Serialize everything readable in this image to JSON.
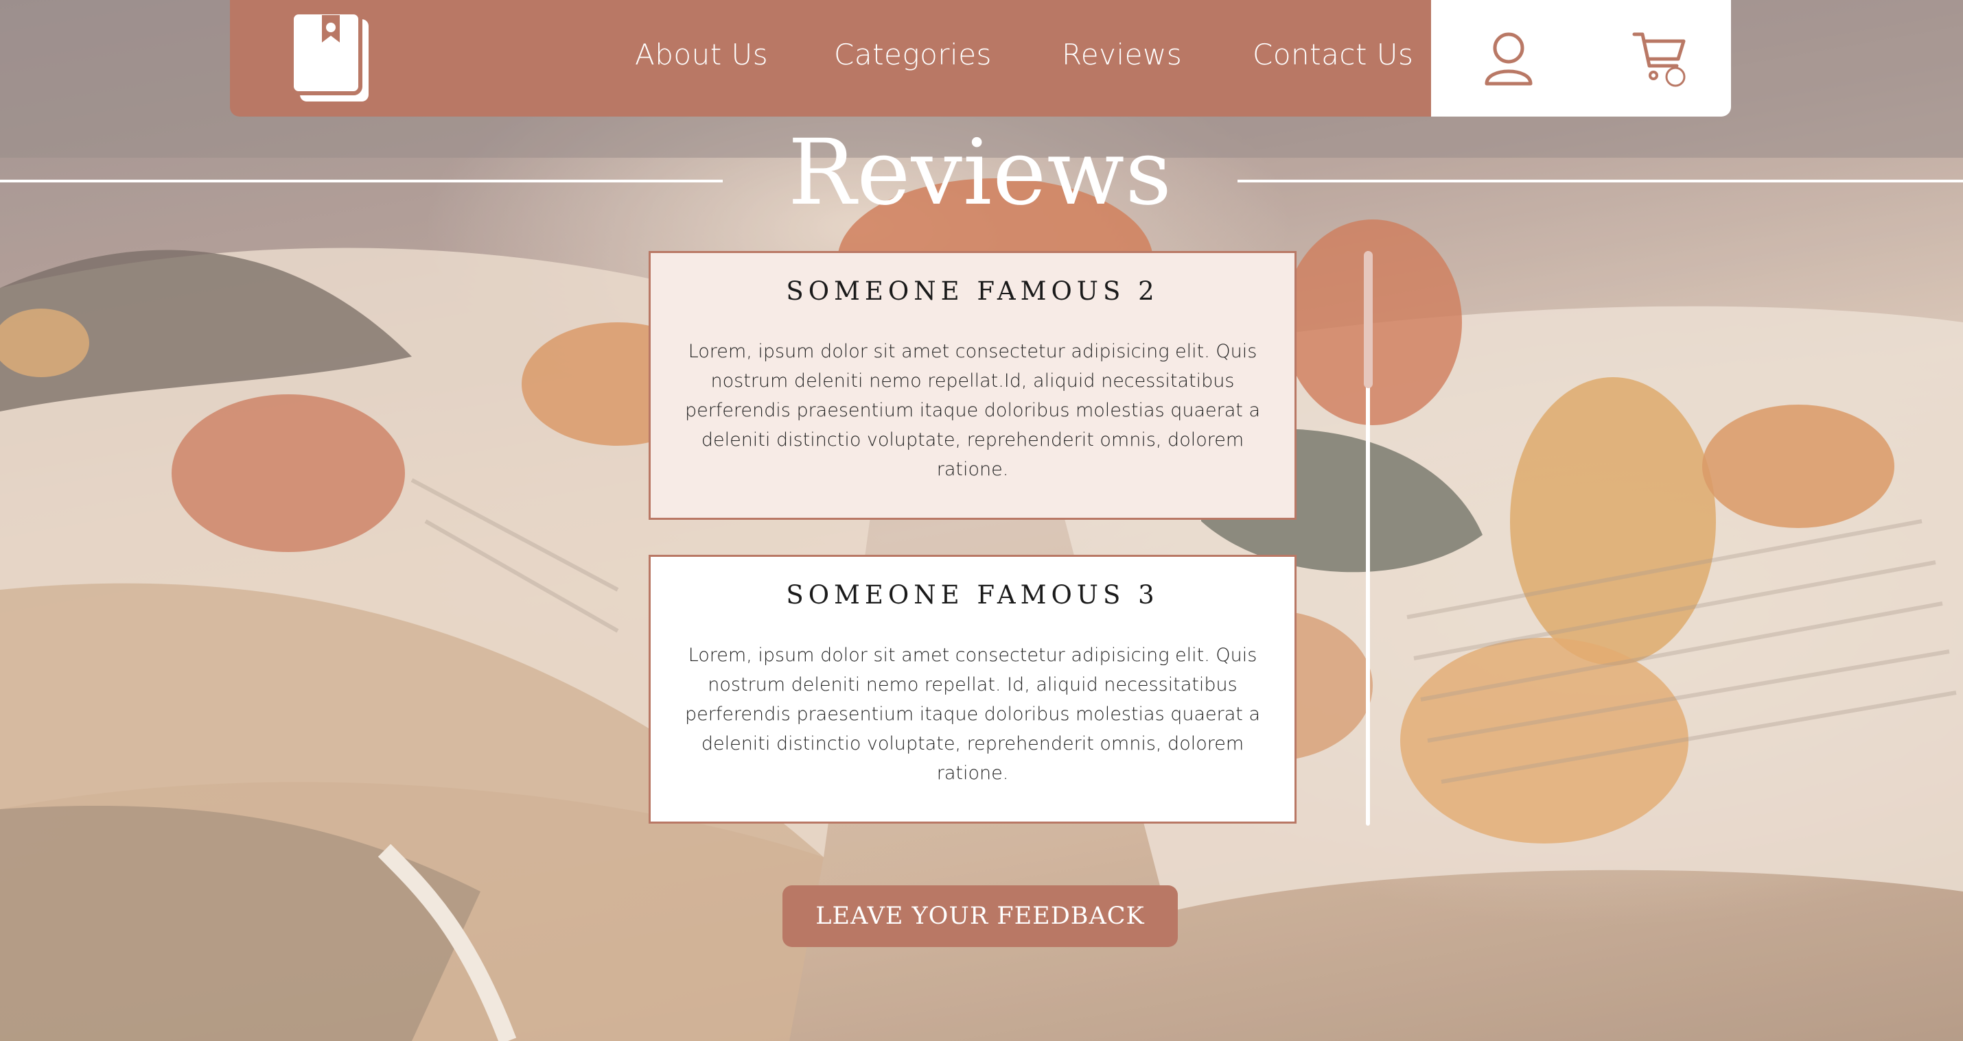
{
  "colors": {
    "brand": "#b97865",
    "card_highlight": "#f7ebe6",
    "white": "#ffffff",
    "scroll_thumb": "#e6c7bd"
  },
  "header": {
    "logo_icon": "book-bookmark-icon",
    "nav": [
      {
        "label": "About Us"
      },
      {
        "label": "Categories"
      },
      {
        "label": "Reviews"
      },
      {
        "label": "Contact Us"
      }
    ],
    "actions": {
      "user_icon": "user-icon",
      "cart_icon": "cart-icon"
    }
  },
  "section": {
    "title": "Reviews"
  },
  "reviews": [
    {
      "name": "SOMEONE FAMOUS 2",
      "text": "Lorem, ipsum dolor sit amet consectetur adipisicing elit. Quis nostrum deleniti nemo repellat.Id, aliquid necessitatibus perferendis praesentium itaque doloribus molestias quaerat a deleniti distinctio voluptate, reprehenderit omnis, dolorem ratione."
    },
    {
      "name": "SOMEONE FAMOUS 3",
      "text": "Lorem, ipsum dolor sit amet consectetur adipisicing elit. Quis nostrum deleniti nemo repellat. Id, aliquid necessitatibus perferendis praesentium itaque doloribus molestias quaerat a deleniti distinctio voluptate, reprehenderit omnis, dolorem ratione."
    }
  ],
  "feedback": {
    "button_label": "LEAVE YOUR FEEDBACK"
  }
}
